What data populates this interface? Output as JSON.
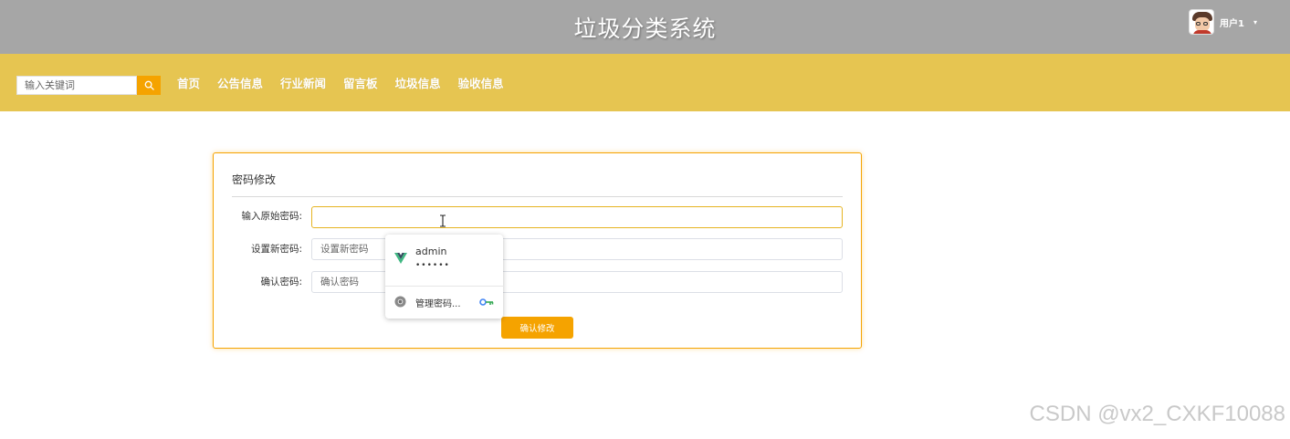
{
  "header": {
    "site_title": "垃圾分类系统",
    "user": {
      "name": "用户1",
      "caret": "▾"
    }
  },
  "navbar": {
    "search": {
      "placeholder": "输入关键词"
    },
    "items": [
      "首页",
      "公告信息",
      "行业新闻",
      "留言板",
      "垃圾信息",
      "验收信息"
    ]
  },
  "form": {
    "title": "密码修改",
    "fields": [
      {
        "label": "输入原始密码:",
        "value": "",
        "placeholder": ""
      },
      {
        "label": "设置新密码:",
        "value": "",
        "placeholder": "设置新密码"
      },
      {
        "label": "确认密码:",
        "value": "",
        "placeholder": "确认密码"
      }
    ],
    "submit_label": "确认修改"
  },
  "autofill": {
    "username": "admin",
    "password_mask": "••••••",
    "manage_label": "管理密码..."
  },
  "colors": {
    "topbar": "#a6a6a6",
    "navbar": "#e6c551",
    "accent": "#f5a300"
  },
  "watermark": "CSDN @vx2_CXKF10088"
}
